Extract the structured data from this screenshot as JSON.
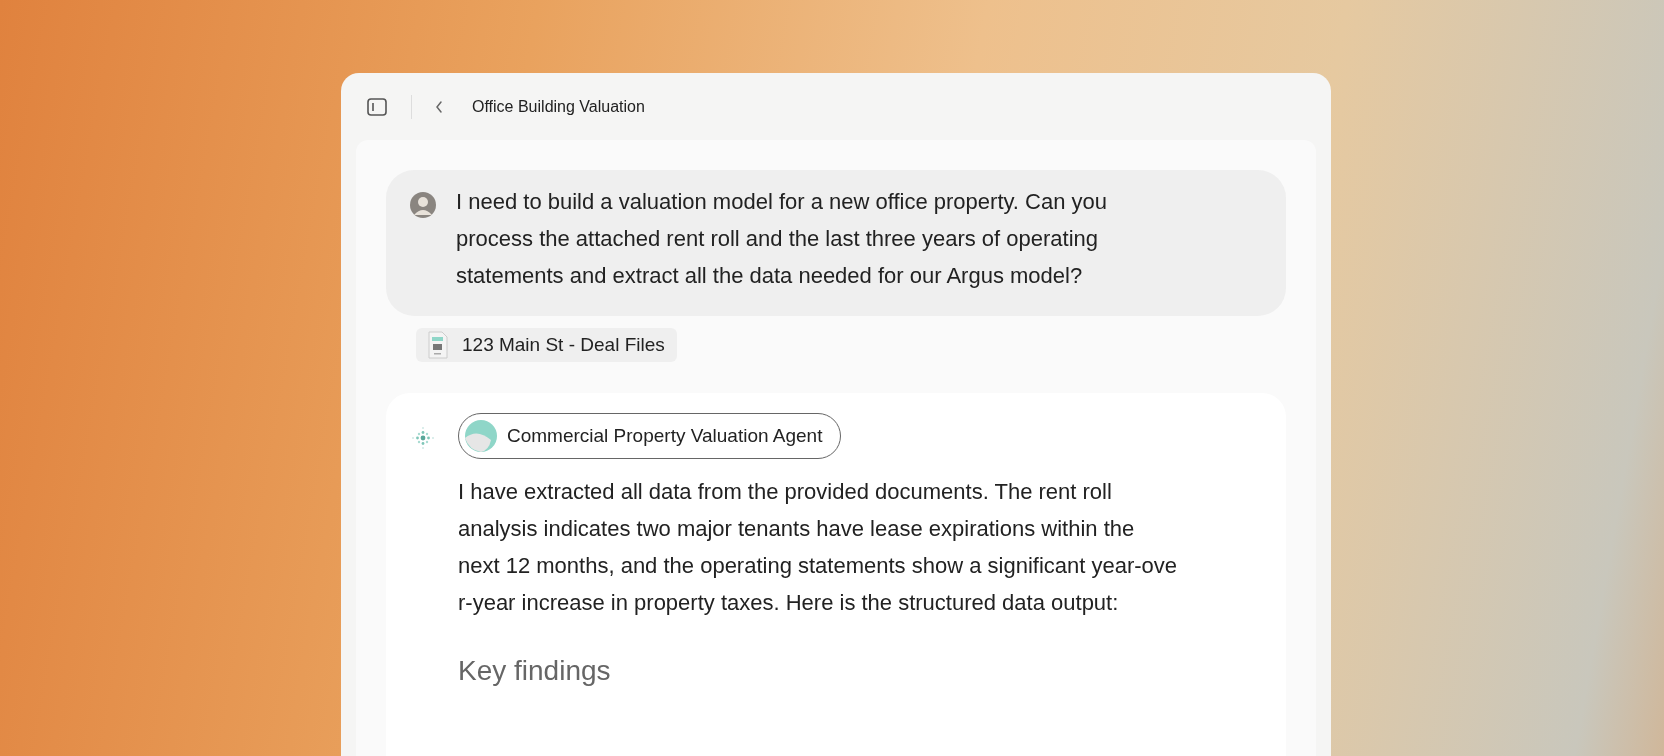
{
  "window": {
    "title": "Office Building Valuation"
  },
  "user_message": {
    "text": "I need to build a valuation model for a new office property. Can you\nprocess the attached rent roll and the last three years of operating\nstatements and extract all the data needed for our Argus model?"
  },
  "attachment": {
    "label": "123 Main St - Deal Files"
  },
  "agent_message": {
    "agent": "Commercial Property Valuation Agent",
    "text": "I have extracted all data from the provided documents. The rent roll\nanalysis indicates two major tenants have lease expirations within the\nnext 12 months, and the operating statements show a significant year-ove\nr-year increase in property taxes. Here is the structured data output:",
    "heading": "Key findings"
  }
}
